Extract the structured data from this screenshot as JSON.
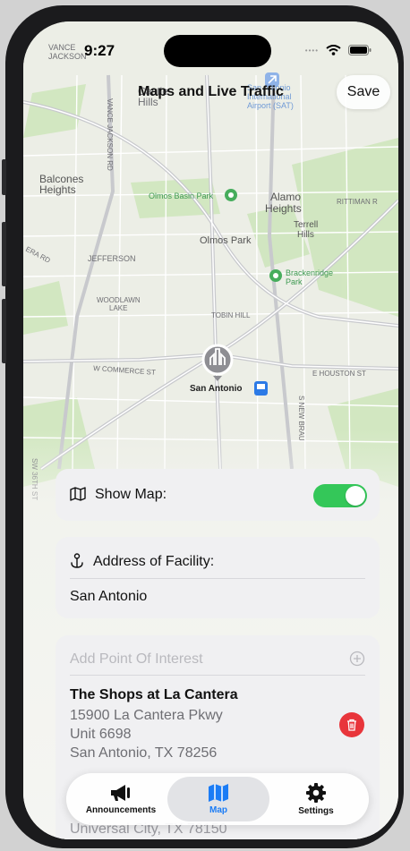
{
  "status": {
    "time": "9:27"
  },
  "nav": {
    "title": "Maps and Live Traffic",
    "save_label": "Save"
  },
  "map": {
    "labels": {
      "vance_jackson": "VANCE\nJACKSON",
      "castle_hills": "Castle\nHills",
      "airport": "San Antonio\nInternational\nAirport (SAT)",
      "vance_jackson_rd": "VANCE JACKSON RD",
      "balcones": "Balcones\nHeights",
      "olmos_basin": "Olmos Basin Park",
      "alamo": "Alamo\nHeights",
      "rittiman": "RITTIMAN R",
      "terrell": "Terrell\nHills",
      "olmos_park": "Olmos Park",
      "jefferson": "JEFFERSON",
      "brackenridge": "Brackenridge\nPark",
      "woodlawn": "WOODLAWN\nLAKE",
      "tobin": "TOBIN HILL",
      "w_commerce": "W COMMERCE ST",
      "e_houston": "E HOUSTON ST",
      "pin": "San Antonio",
      "new_brau": "S NEW BRAU",
      "sw_36th": "SW 36TH ST",
      "era_rd": "ERA RD"
    }
  },
  "show_map": {
    "label": "Show Map:",
    "enabled": true
  },
  "address": {
    "label": "Address of Facility:",
    "value": "San Antonio"
  },
  "poi": {
    "placeholder": "Add Point Of Interest",
    "item": {
      "name": "The Shops at La Cantera",
      "line1": "15900 La Cantera Pkwy",
      "line2": "Unit 6698",
      "line3": "San Antonio, TX 78256"
    },
    "partial_line": "Universal City, TX 78150"
  },
  "tabs": [
    {
      "label": "Announcements",
      "icon": "megaphone-icon"
    },
    {
      "label": "Map",
      "icon": "map-icon"
    },
    {
      "label": "Settings",
      "icon": "gear-icon"
    }
  ],
  "colors": {
    "toggle_on": "#34c759",
    "accent": "#1b7cf5",
    "delete": "#e8353b"
  }
}
